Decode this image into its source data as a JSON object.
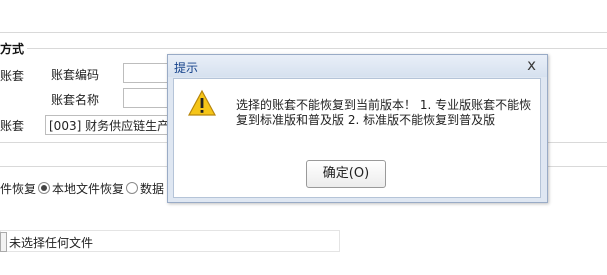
{
  "form": {
    "section_title": "方式",
    "label_row1_prefix": "账套",
    "label_code": "账套编码",
    "label_name": "账套名称",
    "label_row3_prefix": "账套",
    "selected_account": "[003] 财务供应链生产",
    "restore_options": {
      "prefix": "件恢复",
      "local_label": "本地文件恢复",
      "data_label": "数据"
    },
    "file_status": "未选择任何文件"
  },
  "dialog": {
    "title": "提示",
    "close_symbol": "x",
    "icon": "warning-icon",
    "message": "选择的账套不能恢复到当前版本！ 1. 专业版账套不能恢复到标准版和普及版 2. 标准版不能恢复到普及版",
    "ok_label": "确定(O)"
  }
}
